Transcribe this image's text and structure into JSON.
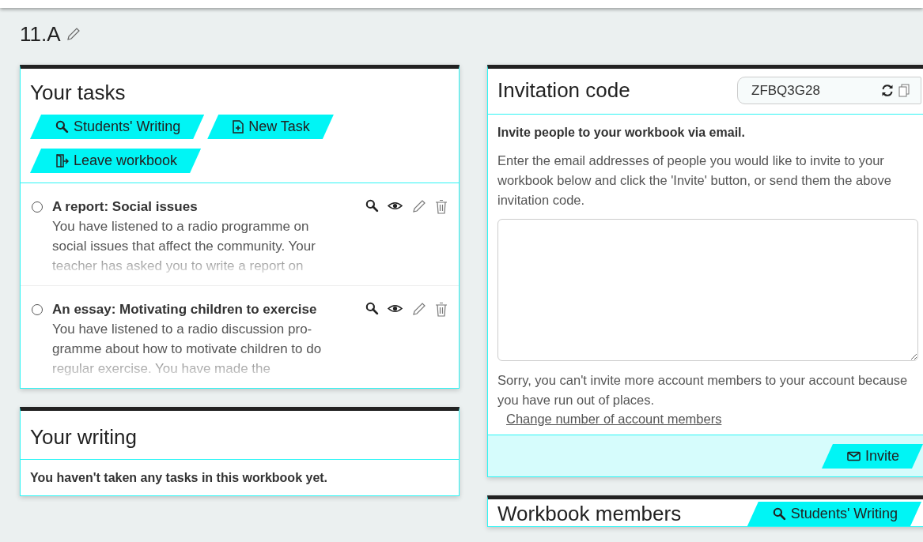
{
  "workbook": {
    "title": "11.A"
  },
  "tasks_panel": {
    "title": "Your tasks",
    "buttons": [
      {
        "label": "Students' Writing",
        "kind": "search"
      },
      {
        "label": "New Task",
        "kind": "new"
      },
      {
        "label": "Leave workbook",
        "kind": "leave"
      }
    ],
    "tasks": [
      {
        "title": "A report: Social issues",
        "description": "You have listened to a radio programme on social issues that affect the community. Your teacher has asked you to write a report on",
        "selected": false
      },
      {
        "title": "An essay: Motivating children to exercise",
        "description": "You have listened to a radio discussion pro-gramme about how to motivate children to do regular exercise. You have made the",
        "selected": false
      }
    ]
  },
  "writing_panel": {
    "title": "Your writing",
    "message": "You haven't taken any tasks in this workbook yet."
  },
  "invitation_panel": {
    "title": "Invitation code",
    "code": "ZFBQ3G28",
    "intro": "Invite people to your workbook via email.",
    "instructions": "Enter the email addresses of people you would like to invite to your workbook below and click the 'Invite' button, or send them the above invitation code.",
    "notice": "Sorry, you can't invite more account members to your account because you have run out of places.",
    "link": "Change number of account members",
    "invite_button": {
      "label": "Invite",
      "kind": "mail"
    }
  },
  "members_panel": {
    "title": "Workbook members",
    "button": {
      "label": "Students' Writing",
      "kind": "search"
    }
  }
}
